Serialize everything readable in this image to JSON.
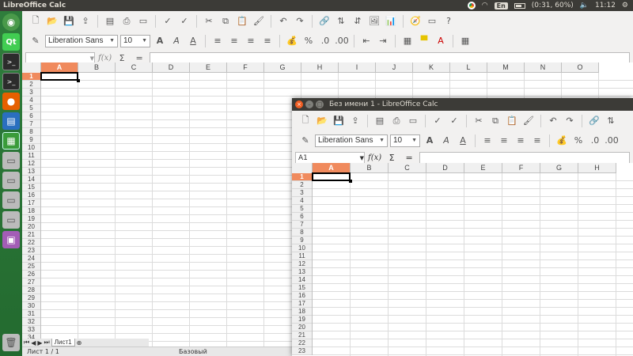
{
  "topbar": {
    "app_title": "LibreOffice Calc",
    "keyboard": "En",
    "battery": "(0:31, 60%)",
    "time": "11:12"
  },
  "launcher": {
    "items": [
      "home",
      "qt-creator",
      "terminal",
      "terminal",
      "firefox",
      "writer",
      "calc",
      "drive",
      "drive",
      "drive",
      "drive",
      "impress"
    ]
  },
  "main_window": {
    "font_name": "Liberation Sans",
    "font_size": "10",
    "name_box": "",
    "columns": [
      "A",
      "B",
      "C",
      "D",
      "E",
      "F",
      "G",
      "H",
      "I",
      "J",
      "K",
      "L",
      "M",
      "N",
      "O"
    ],
    "rows": [
      "1",
      "2",
      "3",
      "4",
      "5",
      "6",
      "7",
      "8",
      "9",
      "10",
      "11",
      "12",
      "13",
      "14",
      "15",
      "16",
      "17",
      "18",
      "19",
      "20",
      "21",
      "22",
      "23",
      "24",
      "25",
      "26",
      "27",
      "28",
      "29",
      "30",
      "31",
      "32",
      "33",
      "34"
    ],
    "active_col": "A",
    "active_row": "1",
    "sheet_tab": "Лист1",
    "status_sheet": "Лист 1 / 1",
    "status_style": "Базовый"
  },
  "second_window": {
    "title": "Без имени 1 - LibreOffice Calc",
    "font_name": "Liberation Sans",
    "font_size": "10",
    "name_box": "A1",
    "columns": [
      "A",
      "B",
      "C",
      "D",
      "E",
      "F",
      "G",
      "H"
    ],
    "rows": [
      "1",
      "2",
      "3",
      "4",
      "5",
      "6",
      "7",
      "8",
      "9",
      "10",
      "11",
      "12",
      "13",
      "14",
      "15",
      "16",
      "17",
      "18",
      "19",
      "20",
      "21",
      "22",
      "23"
    ]
  }
}
